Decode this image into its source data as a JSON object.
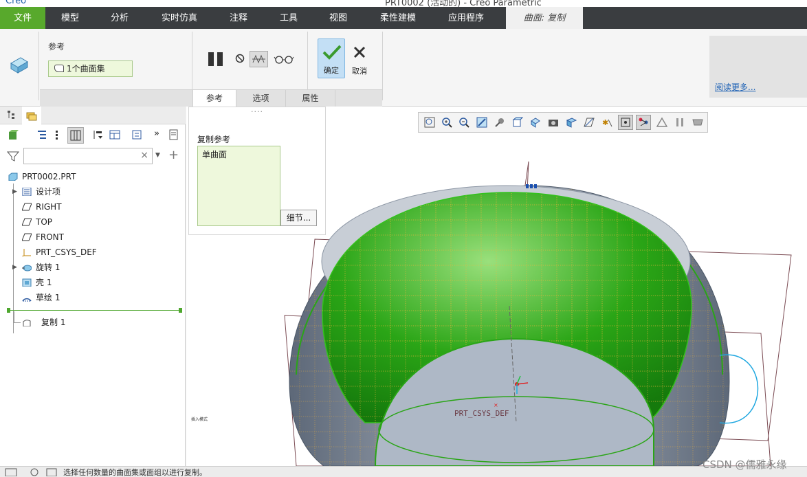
{
  "window": {
    "app_name": "Creo",
    "title": "PRT0002 (活动的) - Creo Parametric"
  },
  "ribbon_tabs": [
    {
      "label": "文件"
    },
    {
      "label": "模型"
    },
    {
      "label": "分析"
    },
    {
      "label": "实时仿真"
    },
    {
      "label": "注释"
    },
    {
      "label": "工具"
    },
    {
      "label": "视图"
    },
    {
      "label": "柔性建模"
    },
    {
      "label": "应用程序"
    },
    {
      "label": "曲面: 复制"
    }
  ],
  "ribbon": {
    "ref_label": "参考",
    "ref_value": "1个曲面集",
    "ok_label": "确定",
    "cancel_label": "取消",
    "read_more": "阅读更多...",
    "bottom_tabs": [
      "参考",
      "选项",
      "属性"
    ]
  },
  "panel": {
    "caption": "复制参考",
    "item": "单曲面",
    "detail_button": "细节..."
  },
  "tree": {
    "filter_placeholder": "",
    "items": [
      {
        "label": "PRT0002.PRT"
      },
      {
        "label": "设计项"
      },
      {
        "label": "RIGHT"
      },
      {
        "label": "TOP"
      },
      {
        "label": "FRONT"
      },
      {
        "label": "PRT_CSYS_DEF"
      },
      {
        "label": "旋转 1"
      },
      {
        "label": "壳 1"
      },
      {
        "label": "草绘 1"
      },
      {
        "label": "复制 1"
      }
    ]
  },
  "viewport": {
    "csys_label": "PRT_CSYS_DEF",
    "insert_mode": "插入模式"
  },
  "status": {
    "message": "选择任何数量的曲面集或面组以进行复制。"
  },
  "watermark": "CSDN @儒雅永缘",
  "colors": {
    "file_tab": "#58a92c",
    "tab_bar": "#3a3d40",
    "selected_surface": "#22a512",
    "reference_box": "#eef8dc",
    "ok_button": "#c3dff5"
  }
}
